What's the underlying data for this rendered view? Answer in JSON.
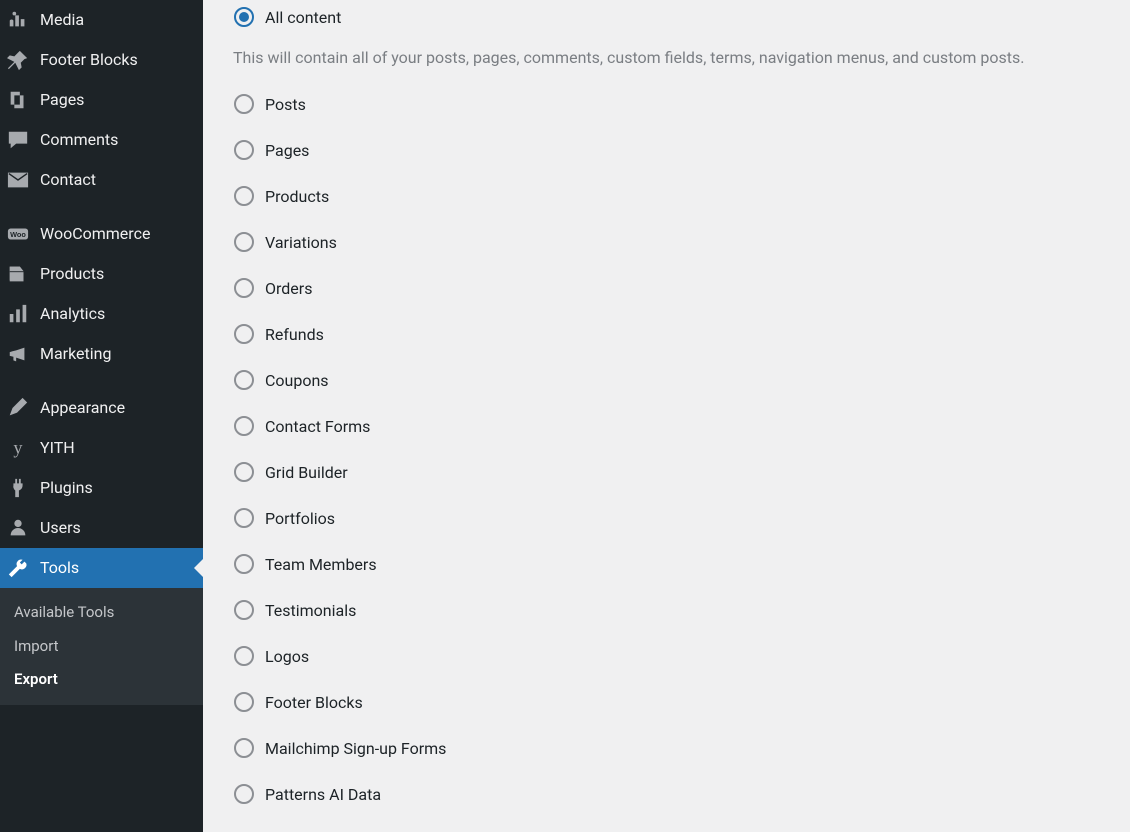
{
  "sidebar": {
    "items": [
      {
        "key": "media",
        "label": "Media",
        "icon": "media-icon"
      },
      {
        "key": "footer-blocks",
        "label": "Footer Blocks",
        "icon": "pin-icon"
      },
      {
        "key": "pages",
        "label": "Pages",
        "icon": "pages-icon"
      },
      {
        "key": "comments",
        "label": "Comments",
        "icon": "comment-icon"
      },
      {
        "key": "contact",
        "label": "Contact",
        "icon": "envelope-icon"
      },
      {
        "key": "_sep1",
        "sep": true
      },
      {
        "key": "woocommerce",
        "label": "WooCommerce",
        "icon": "woo-icon"
      },
      {
        "key": "products",
        "label": "Products",
        "icon": "cart-icon"
      },
      {
        "key": "analytics",
        "label": "Analytics",
        "icon": "analytics-icon"
      },
      {
        "key": "marketing",
        "label": "Marketing",
        "icon": "megaphone-icon"
      },
      {
        "key": "_sep2",
        "sep": true
      },
      {
        "key": "appearance",
        "label": "Appearance",
        "icon": "appearance-icon"
      },
      {
        "key": "yith",
        "label": "YITH",
        "icon": "yith-icon"
      },
      {
        "key": "plugins",
        "label": "Plugins",
        "icon": "plugins-icon"
      },
      {
        "key": "users",
        "label": "Users",
        "icon": "users-icon"
      },
      {
        "key": "tools",
        "label": "Tools",
        "icon": "tools-icon",
        "active": true
      }
    ],
    "submenu": [
      {
        "key": "available-tools",
        "label": "Available Tools"
      },
      {
        "key": "import",
        "label": "Import"
      },
      {
        "key": "export",
        "label": "Export",
        "current": true
      }
    ]
  },
  "export": {
    "primary": {
      "label": "All content",
      "checked": true
    },
    "description": "This will contain all of your posts, pages, comments, custom fields, terms, navigation menus, and custom posts.",
    "options": [
      {
        "key": "posts",
        "label": "Posts"
      },
      {
        "key": "pages",
        "label": "Pages"
      },
      {
        "key": "products",
        "label": "Products"
      },
      {
        "key": "variations",
        "label": "Variations"
      },
      {
        "key": "orders",
        "label": "Orders"
      },
      {
        "key": "refunds",
        "label": "Refunds"
      },
      {
        "key": "coupons",
        "label": "Coupons"
      },
      {
        "key": "contact-forms",
        "label": "Contact Forms"
      },
      {
        "key": "grid-builder",
        "label": "Grid Builder"
      },
      {
        "key": "portfolios",
        "label": "Portfolios"
      },
      {
        "key": "team-members",
        "label": "Team Members"
      },
      {
        "key": "testimonials",
        "label": "Testimonials"
      },
      {
        "key": "logos",
        "label": "Logos"
      },
      {
        "key": "footer-blocks",
        "label": "Footer Blocks"
      },
      {
        "key": "mailchimp",
        "label": "Mailchimp Sign-up Forms"
      },
      {
        "key": "patterns-ai",
        "label": "Patterns AI Data"
      }
    ]
  }
}
